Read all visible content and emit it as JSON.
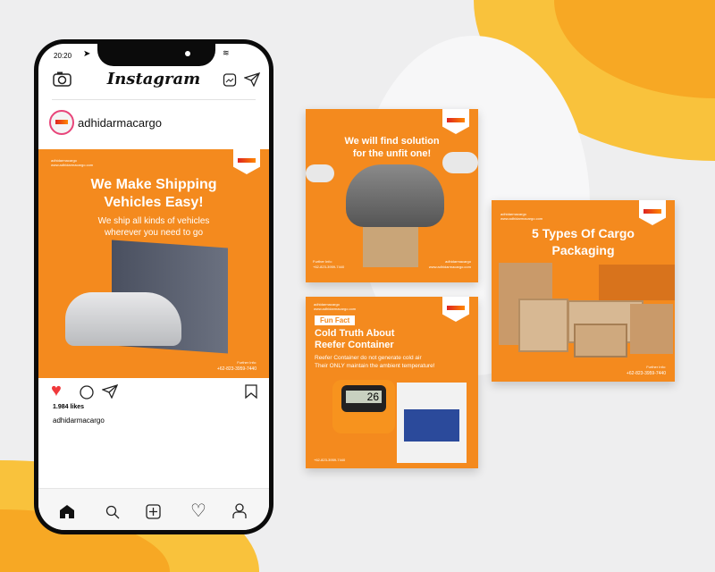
{
  "status_bar": {
    "time": "20:20"
  },
  "header": {
    "title": "Instagram"
  },
  "profile": {
    "username": "adhidarmacargo"
  },
  "post": {
    "title_line1": "We Make Shipping",
    "title_line2": "Vehicles Easy!",
    "subtitle_line1": "We ship all kinds of vehicles",
    "subtitle_line2": "wherever you need to go",
    "handle": "adhidarmacargo",
    "website": "www.adhidarmacargo.com",
    "further_info": "Further Info:",
    "phone": "+62-823-3959-7440",
    "likes": "1.984 likes",
    "caption_user": "adhidarmacargo"
  },
  "cards": [
    {
      "title_line1": "We will find solution",
      "title_line2": "for the unfit one!",
      "further_info": "Further Info:",
      "phone": "+62-823-3959-7440",
      "handle": "adhidarmacargo",
      "website": "www.adhidarmacargo.com"
    },
    {
      "badge": "Fun Fact",
      "title_line1": "Cold Truth About",
      "title_line2": "Reefer Container",
      "body_line1": "Reefer Container do not generate cold air",
      "body_line2": "Their ONLY maintain the ambient temperature!",
      "thermo_reading": "26",
      "handle": "adhidarmacargo",
      "website": "www.adhidarmacargo.com",
      "phone": "+62-823-3959-7440"
    },
    {
      "title_line1": "5 Types Of Cargo",
      "title_line2": "Packaging",
      "further_info": "Further Info:",
      "phone": "+62-823-3959-7440",
      "handle": "adhidarmacargo",
      "website": "www.adhidarmacargo.com"
    }
  ],
  "colors": {
    "brand_orange": "#f48a1e",
    "like_red": "#f0393b",
    "accent_yellow": "#f9c23c"
  }
}
